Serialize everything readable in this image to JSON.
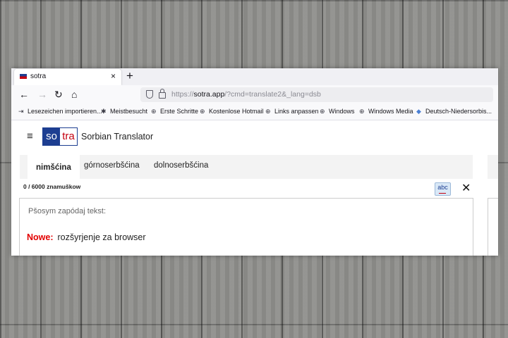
{
  "browser": {
    "tab_title": "sotra",
    "tab_close": "×",
    "new_tab": "+",
    "nav": {
      "back": "←",
      "forward": "→",
      "reload": "↻",
      "home": "⌂"
    },
    "url_prefix": "https://",
    "url_host": "sotra.app",
    "url_path": "/?cmd=translate2&_lang=dsb",
    "bookmarks": [
      {
        "icon": "import-icon",
        "glyph": "⇥",
        "label": "Lesezeichen importieren..."
      },
      {
        "icon": "gear-icon",
        "glyph": "✱",
        "label": "Meistbesucht"
      },
      {
        "icon": "globe-icon",
        "glyph": "⊕",
        "label": "Erste Schritte"
      },
      {
        "icon": "globe-icon",
        "glyph": "⊕",
        "label": "Kostenlose Hotmail"
      },
      {
        "icon": "globe-icon",
        "glyph": "⊕",
        "label": "Links anpassen"
      },
      {
        "icon": "globe-icon",
        "glyph": "⊕",
        "label": "Windows"
      },
      {
        "icon": "globe-icon",
        "glyph": "⊕",
        "label": "Windows Media"
      },
      {
        "icon": "translator-icon",
        "glyph": "◆",
        "label": "Deutsch-Niedersorbis..."
      }
    ]
  },
  "app": {
    "menu_glyph": "≡",
    "logo_left": "so",
    "logo_right": "tra",
    "title": "Sorbian Translator",
    "tabs": [
      {
        "label": "nimšćina",
        "active": true
      },
      {
        "label": "górnoserbšćina",
        "active": false
      },
      {
        "label": "dolnoserbšćina",
        "active": false
      }
    ],
    "counter": "0 / 6000 znamuškow",
    "spell_label": "abc",
    "close_glyph": "✕",
    "input_placeholder": "Pšosym zapódaj tekst:",
    "news_label": "Nowe:",
    "news_text": "rozšyrjenje za browser"
  },
  "colors": {
    "brand_blue": "#1d3e91",
    "brand_red": "#c4000f",
    "news_red": "#e30000"
  }
}
